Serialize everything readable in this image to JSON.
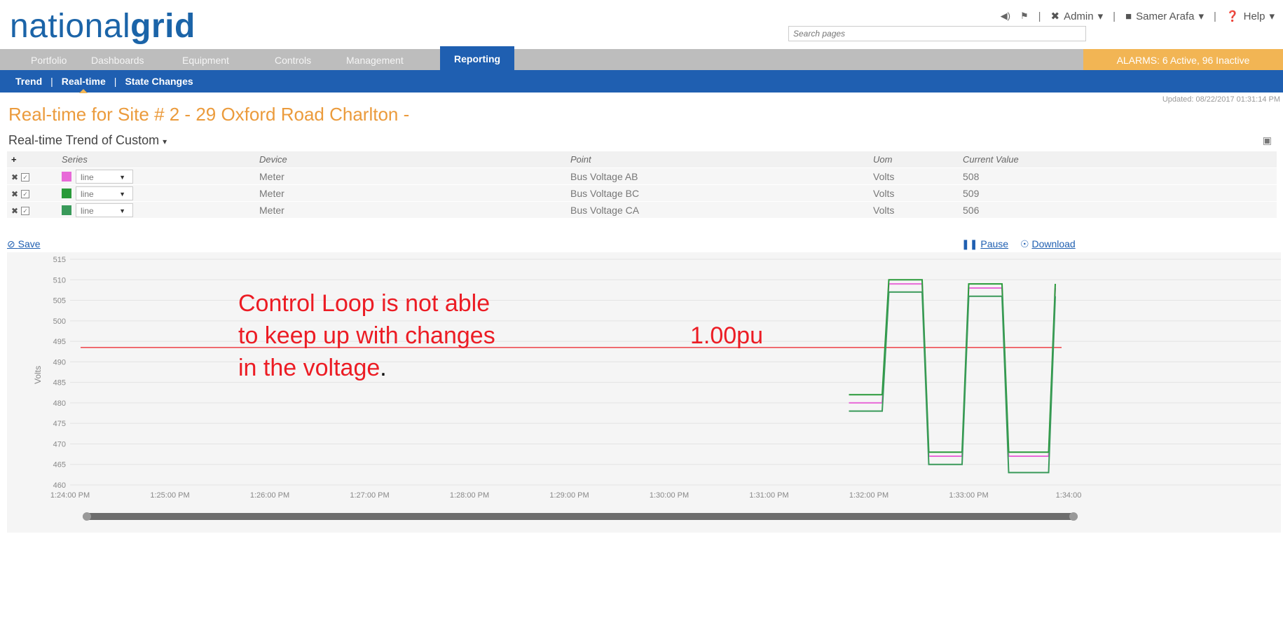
{
  "logo": {
    "prefix": "national",
    "suffix": "grid"
  },
  "topbar": {
    "admin": "Admin",
    "user": "Samer Arafa",
    "help": "Help",
    "search_placeholder": "Search pages",
    "icons": [
      "speaker-icon",
      "flag-icon",
      "tools-icon",
      "user-icon",
      "help-circle-icon"
    ]
  },
  "mainnav": {
    "tabs": [
      "Portfolio",
      "Dashboards",
      "Equipment",
      "Controls",
      "Management",
      "Reporting"
    ],
    "active": "Reporting",
    "alarms": "ALARMS: 6 Active, 96 Inactive"
  },
  "subnav": {
    "items": [
      "Trend",
      "Real-time",
      "State Changes"
    ],
    "active": "Real-time"
  },
  "updated": "Updated: 08/22/2017 01:31:14 PM",
  "page_title": "Real-time for Site # 2 - 29 Oxford Road Charlton -",
  "subtitle": "Real-time Trend of Custom",
  "table": {
    "headers": [
      "Series",
      "Device",
      "Point",
      "Uom",
      "Current Value"
    ],
    "rows": [
      {
        "color": "#e86ad8",
        "type": "line",
        "device": "Meter",
        "point": "Bus Voltage AB",
        "uom": "Volts",
        "value": "508"
      },
      {
        "color": "#2a9a3a",
        "type": "line",
        "device": "Meter",
        "point": "Bus Voltage BC",
        "uom": "Volts",
        "value": "509"
      },
      {
        "color": "#3a9a5a",
        "type": "line",
        "device": "Meter",
        "point": "Bus Voltage CA",
        "uom": "Volts",
        "value": "506"
      }
    ]
  },
  "actions": {
    "save": "Save",
    "pause": "Pause",
    "download": "Download"
  },
  "annotation": {
    "line1": "Control Loop is not able",
    "line2": "to keep up with changes",
    "line3_red": "in the voltage",
    "line3_black": ".",
    "pu_label": "1.00pu"
  },
  "colors": {
    "brand": "#1b64a8",
    "nav_blue": "#1f5fb1",
    "orange": "#eb9b3c",
    "alarm": "#f2b554",
    "annotation": "#ec1c24"
  },
  "chart_data": {
    "type": "line",
    "ylabel": "Volts",
    "ylim": [
      460,
      515
    ],
    "yticks": [
      460,
      465,
      470,
      475,
      480,
      485,
      490,
      495,
      500,
      505,
      510,
      515
    ],
    "x_ticks": [
      "1:24:00 PM",
      "1:25:00 PM",
      "1:26:00 PM",
      "1:27:00 PM",
      "1:28:00 PM",
      "1:29:00 PM",
      "1:30:00 PM",
      "1:31:00 PM",
      "1:32:00 PM",
      "1:33:00 PM",
      "1:34:00"
    ],
    "reference_line": {
      "label": "1.00pu",
      "y": 493.5
    },
    "series": [
      {
        "color": "#e86ad8",
        "x": [
          "1:31:48 PM",
          "1:32:08 PM",
          "1:32:12 PM",
          "1:32:32 PM",
          "1:32:36 PM",
          "1:32:56 PM",
          "1:33:00 PM",
          "1:33:20 PM",
          "1:33:24 PM",
          "1:33:48 PM",
          "1:33:52 PM"
        ],
        "y": [
          480,
          480,
          509,
          509,
          467,
          467,
          508,
          508,
          467,
          467,
          508
        ]
      },
      {
        "color": "#2a9a3a",
        "x": [
          "1:31:48 PM",
          "1:32:08 PM",
          "1:32:12 PM",
          "1:32:32 PM",
          "1:32:36 PM",
          "1:32:56 PM",
          "1:33:00 PM",
          "1:33:20 PM",
          "1:33:24 PM",
          "1:33:48 PM",
          "1:33:52 PM"
        ],
        "y": [
          482,
          482,
          510,
          510,
          468,
          468,
          509,
          509,
          468,
          468,
          509
        ]
      },
      {
        "color": "#3a9a5a",
        "x": [
          "1:31:48 PM",
          "1:32:08 PM",
          "1:32:12 PM",
          "1:32:32 PM",
          "1:32:36 PM",
          "1:32:56 PM",
          "1:33:00 PM",
          "1:33:20 PM",
          "1:33:24 PM",
          "1:33:48 PM",
          "1:33:52 PM"
        ],
        "y": [
          478,
          478,
          507,
          507,
          465,
          465,
          506,
          506,
          463,
          463,
          506
        ]
      }
    ]
  }
}
